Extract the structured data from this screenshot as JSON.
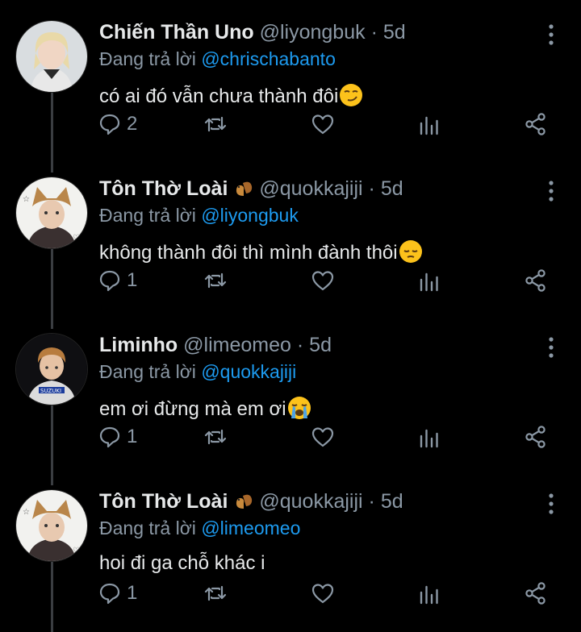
{
  "tweets": [
    {
      "name": "Chiến Thần Uno",
      "handle": "@liyongbuk",
      "time": "5d",
      "reply_prefix": "Đang trả lời",
      "reply_to": "@chrischabanto",
      "text": "có ai đó vẫn chưa thành đôi",
      "emoji": "smirking-face",
      "replies": "2",
      "has_badge": false
    },
    {
      "name": "Tôn Thờ Loài",
      "handle": "@quokkajiji",
      "time": "5d",
      "reply_prefix": "Đang trả lời",
      "reply_to": "@liyongbuk",
      "text": "không thành đôi thì mình đành thôi",
      "emoji": "pensive-face",
      "replies": "1",
      "has_badge": true
    },
    {
      "name": "Liminho",
      "handle": "@limeomeo",
      "time": "5d",
      "reply_prefix": "Đang trả lời",
      "reply_to": "@quokkajiji",
      "text": "em ơi đừng mà em ơi",
      "emoji": "loudly-crying-face",
      "replies": "1",
      "has_badge": false
    },
    {
      "name": "Tôn Thờ Loài",
      "handle": "@quokkajiji",
      "time": "5d",
      "reply_prefix": "Đang trả lời",
      "reply_to": "@limeomeo",
      "text": "hoi đi ga chỗ khác i",
      "emoji": "",
      "replies": "1",
      "has_badge": true
    }
  ],
  "separator": "·",
  "colors": {
    "background": "#000000",
    "text": "#e7e9ea",
    "muted": "#8b98a5",
    "link": "#1d9bf0",
    "thread_line": "#3a3d41"
  }
}
